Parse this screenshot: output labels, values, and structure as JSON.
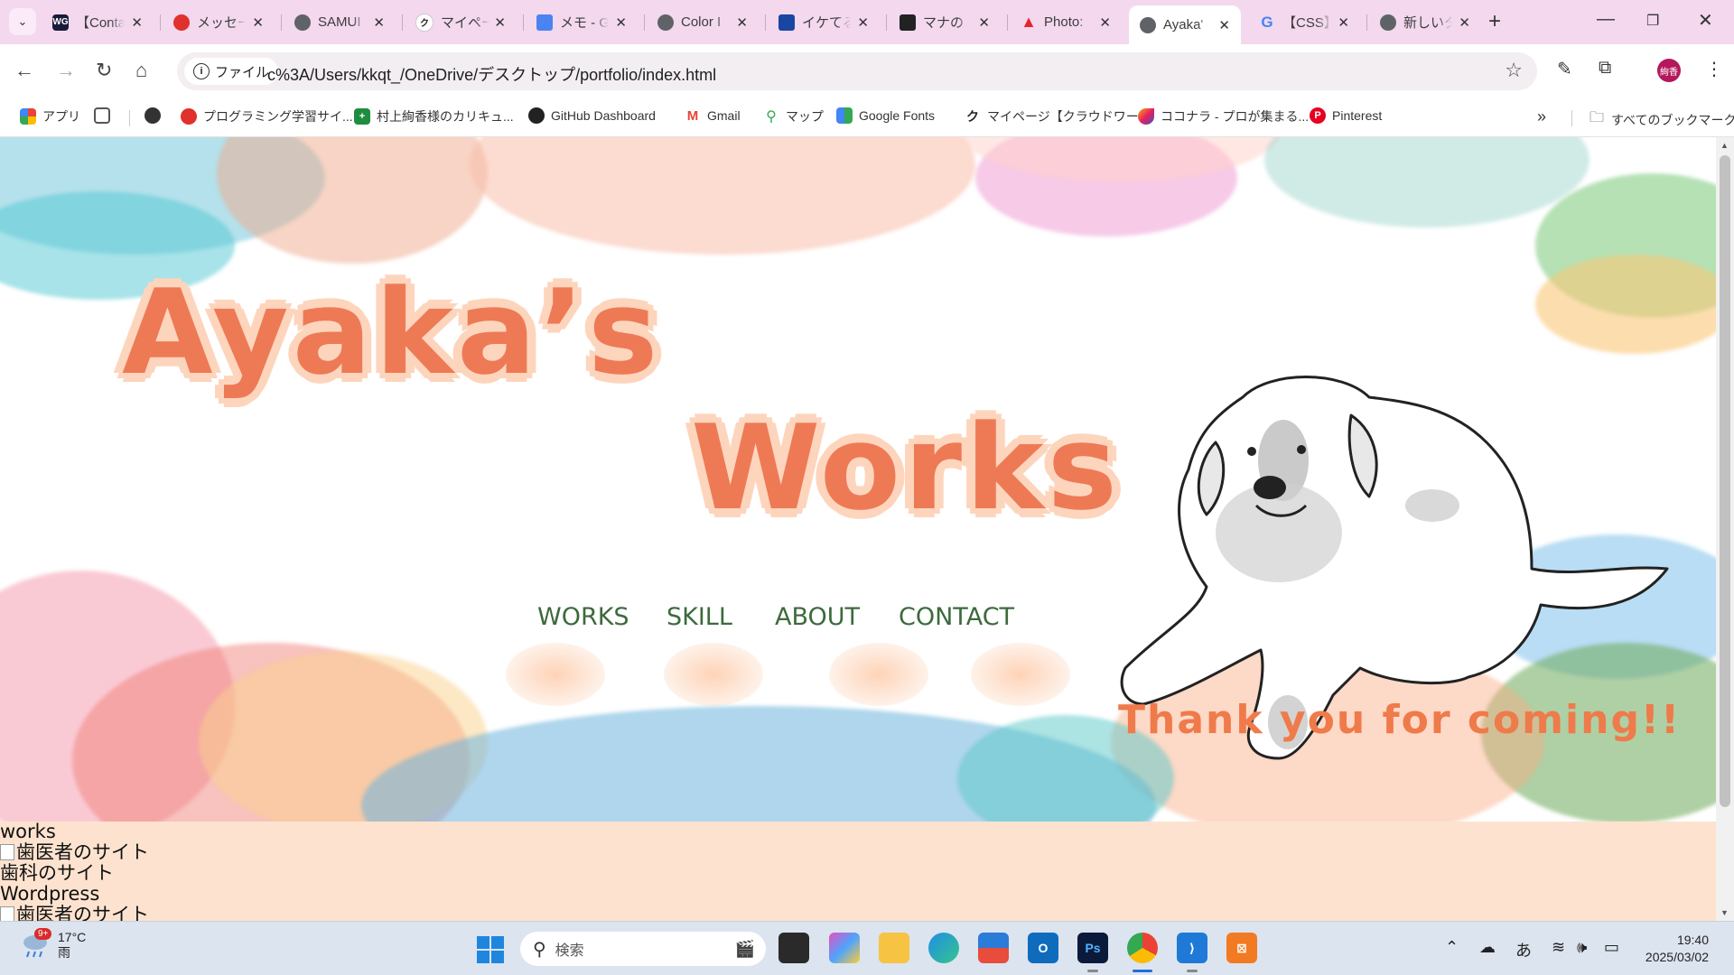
{
  "browser": {
    "tabs": [
      {
        "title": "【Conta",
        "fav_text": "WG",
        "fav_color": "#1a1a3a"
      },
      {
        "title": "メッセー",
        "fav_text": "",
        "fav_color": "#e0312d"
      },
      {
        "title": "SAMUI",
        "fav_text": "",
        "fav_color": "#5f6368"
      },
      {
        "title": "マイペー",
        "fav_text": "ク",
        "fav_color": "#ffffff"
      },
      {
        "title": "メモ - G",
        "fav_text": "",
        "fav_color": "#4a84f0"
      },
      {
        "title": "Color I",
        "fav_text": "",
        "fav_color": "#5f6368"
      },
      {
        "title": "イケてる",
        "fav_text": "",
        "fav_color": "#1846a3"
      },
      {
        "title": "マナの ",
        "fav_text": "",
        "fav_color": "#222222"
      },
      {
        "title": "Photo:",
        "fav_text": "",
        "fav_color": "#e8232a"
      },
      {
        "title": "Ayaka'",
        "fav_text": "",
        "fav_color": "#5f6368",
        "active": true
      },
      {
        "title": "【CSS】",
        "fav_text": "G",
        "fav_color": "#4285f4"
      },
      {
        "title": "新しいタ",
        "fav_text": "",
        "fav_color": "#5f6368"
      }
    ],
    "url_chip": "ファイル",
    "url": "c%3A/Users/kkqt_/OneDrive/デスクトップ/portfolio/index.html",
    "avatar_text": "絢香",
    "bookmarks": [
      {
        "label": "アプリ"
      },
      {
        "label": ""
      },
      {
        "label": ""
      },
      {
        "label": "プログラミング学習サイ..."
      },
      {
        "label": "村上絢香様のカリキュ..."
      },
      {
        "label": "GitHub Dashboard"
      },
      {
        "label": "Gmail"
      },
      {
        "label": "マップ"
      },
      {
        "label": "Google Fonts"
      },
      {
        "label": "マイページ【クラウドワー..."
      },
      {
        "label": "ココナラ - プロが集まる..."
      },
      {
        "label": "Pinterest"
      }
    ],
    "all_bookmarks": "すべてのブックマーク"
  },
  "page": {
    "title_line1": "Ayaka’s",
    "title_line2": "Works",
    "nav": [
      "WORKS",
      "SKILL",
      "ABOUT",
      "CONTACT"
    ],
    "thanks": "Thank you for coming!!",
    "below": {
      "heading": "works",
      "item1_alt": "歯医者のサイト",
      "item1_title": "歯科のサイト",
      "item2_title": "Wordpress",
      "item2_alt": "歯医者のサイト"
    }
  },
  "taskbar": {
    "weather_temp": "17°C",
    "weather_desc": "雨",
    "weather_badge": "9+",
    "search_label": "検索",
    "ime": "あ",
    "time": "19:40",
    "date": "2025/03/02"
  },
  "colors": {
    "tab_strip": "#f3d8ee",
    "title_orange": "#ee7a55",
    "nav_green": "#3d6a3d",
    "below_bg": "#fde3cf"
  }
}
